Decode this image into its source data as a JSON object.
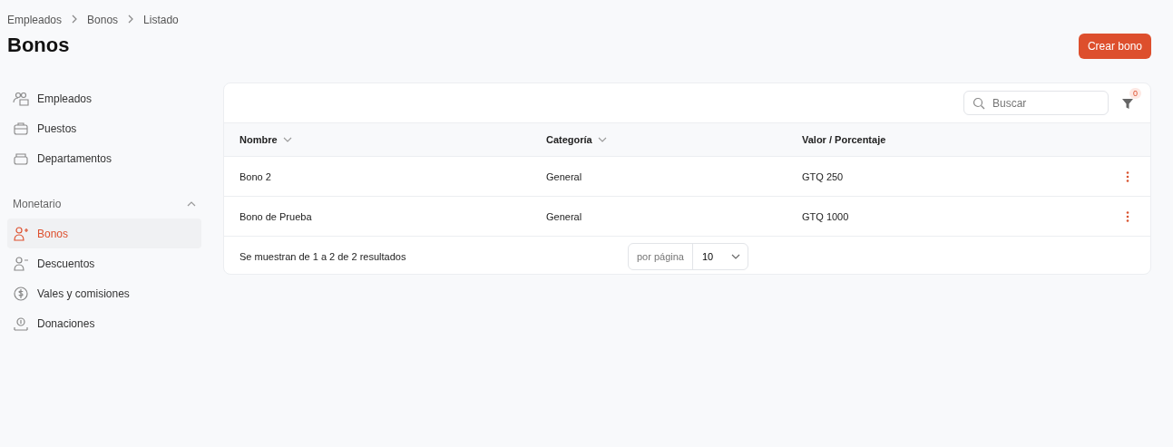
{
  "breadcrumb": [
    "Empleados",
    "Bonos",
    "Listado"
  ],
  "title": "Bonos",
  "create_button": "Crear bono",
  "sidebar": {
    "items": [
      {
        "label": "Empleados",
        "selected": false
      },
      {
        "label": "Puestos",
        "selected": false
      },
      {
        "label": "Departamentos",
        "selected": false
      }
    ],
    "group": {
      "label": "Monetario",
      "expanded": true,
      "items": [
        {
          "label": "Bonos",
          "selected": true
        },
        {
          "label": "Descuentos",
          "selected": false
        },
        {
          "label": "Vales y comisiones",
          "selected": false
        },
        {
          "label": "Donaciones",
          "selected": false
        }
      ]
    }
  },
  "search": {
    "placeholder": "Buscar"
  },
  "filter_count": "0",
  "table": {
    "columns": [
      {
        "label": "Nombre",
        "sortable": true
      },
      {
        "label": "Categoría",
        "sortable": true
      },
      {
        "label": "Valor / Porcentaje",
        "sortable": false
      }
    ],
    "rows": [
      [
        "Bono 2",
        "General",
        "GTQ 250"
      ],
      [
        "Bono de Prueba",
        "General",
        "GTQ 1000"
      ]
    ]
  },
  "footer": {
    "summary": "Se muestran de 1 a 2 de 2 resultados",
    "per_page_label": "por página",
    "per_page": "10"
  }
}
